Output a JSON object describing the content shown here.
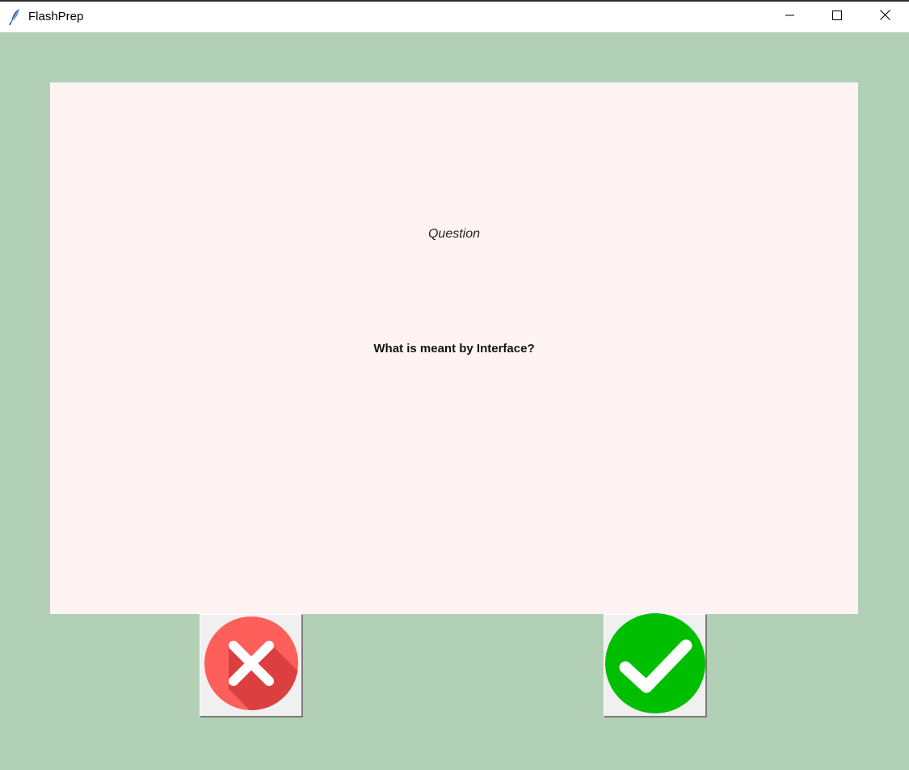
{
  "window": {
    "title": "FlashPrep",
    "controls": {
      "minimize": "minimize-icon",
      "maximize": "maximize-icon",
      "close": "close-icon"
    }
  },
  "card": {
    "label": "Question",
    "text": "What is meant by Interface?"
  },
  "buttons": {
    "wrong": {
      "icon": "cross-icon",
      "color": "#ff5f5a"
    },
    "right": {
      "icon": "check-icon",
      "color": "#00bf00"
    }
  },
  "colors": {
    "background": "#b1d0b6",
    "card": "#fff4f3"
  }
}
